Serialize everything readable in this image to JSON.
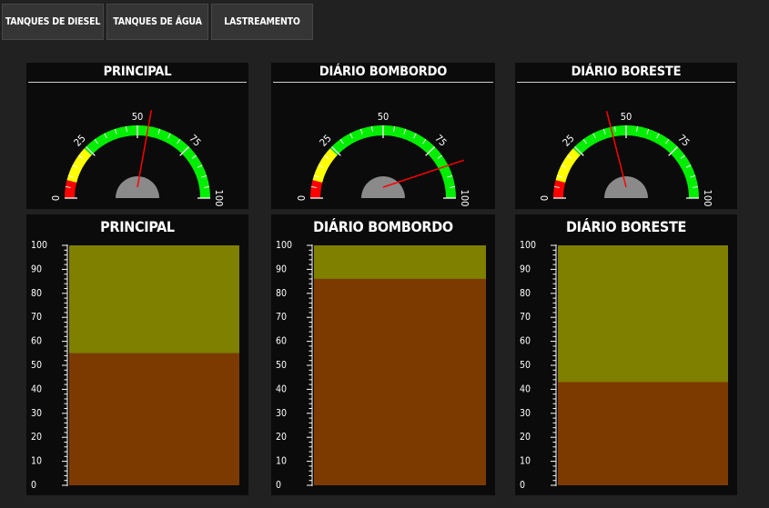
{
  "tabs": [
    {
      "label": "TANQUES DE DIESEL"
    },
    {
      "label": "TANQUES DE ÁGUA"
    },
    {
      "label": "LASTREAMENTO"
    }
  ],
  "colors": {
    "background": "#212121",
    "panel": "#0b0b0b",
    "gauge_red": "#ff0000",
    "gauge_yellow": "#ffff00",
    "gauge_green": "#00ee00",
    "needle": "#ff0000",
    "hub": "#8a8a8a",
    "tank_liquid": "#7d3a00",
    "tank_empty": "#7f7f00"
  },
  "gauges": [
    {
      "title": "PRINCIPAL",
      "value": 55,
      "min": 0,
      "max": 100,
      "tick_labels": [
        "0",
        "25",
        "50",
        "75",
        "100"
      ]
    },
    {
      "title": "DIÁRIO BOMBORDO",
      "value": 86,
      "min": 0,
      "max": 100,
      "tick_labels": [
        "0",
        "25",
        "50",
        "75",
        "100"
      ]
    },
    {
      "title": "DIÁRIO BORESTE",
      "value": 43,
      "min": 0,
      "max": 100,
      "tick_labels": [
        "0",
        "25",
        "50",
        "75",
        "100"
      ]
    }
  ],
  "tanks": [
    {
      "title": "PRINCIPAL",
      "value": 55,
      "min": 0,
      "max": 100,
      "tick_labels": [
        "0",
        "10",
        "20",
        "30",
        "40",
        "50",
        "60",
        "70",
        "80",
        "90",
        "100"
      ]
    },
    {
      "title": "DIÁRIO BOMBORDO",
      "value": 86,
      "min": 0,
      "max": 100,
      "tick_labels": [
        "0",
        "10",
        "20",
        "30",
        "40",
        "50",
        "60",
        "70",
        "80",
        "90",
        "100"
      ]
    },
    {
      "title": "DIÁRIO BORESTE",
      "value": 43,
      "min": 0,
      "max": 100,
      "tick_labels": [
        "0",
        "10",
        "20",
        "30",
        "40",
        "50",
        "60",
        "70",
        "80",
        "90",
        "100"
      ]
    }
  ]
}
